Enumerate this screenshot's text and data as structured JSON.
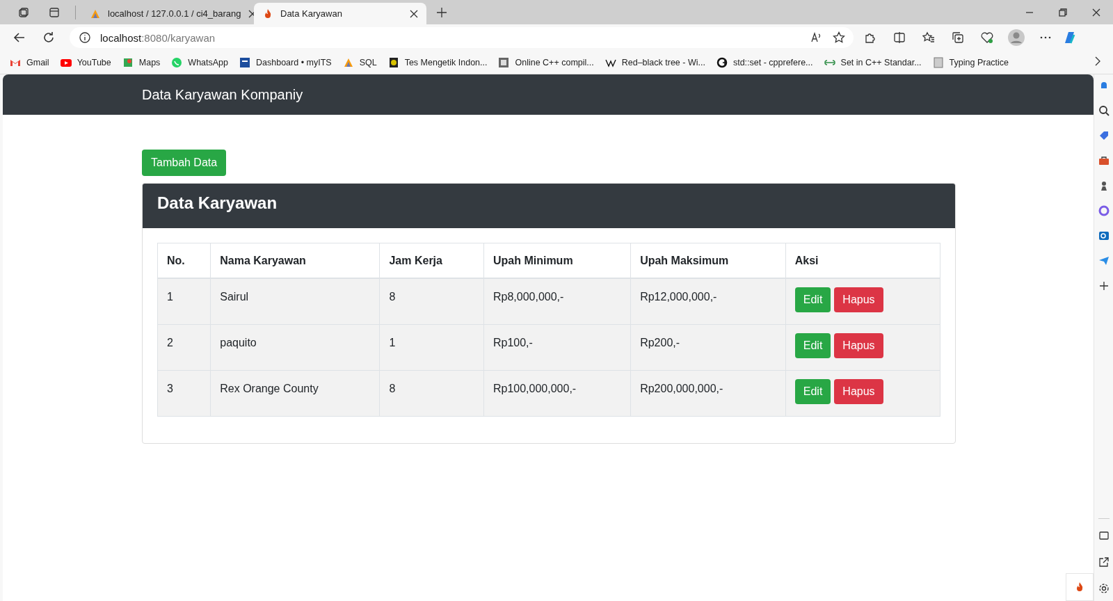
{
  "browser": {
    "tabs": [
      {
        "title": "localhost / 127.0.0.1 / ci4_barang",
        "kind": "pma",
        "selected": false
      },
      {
        "title": "Data Karyawan",
        "kind": "flame",
        "selected": true
      }
    ],
    "address": {
      "host": "localhost",
      "path": ":8080/karyawan"
    },
    "bookmarks": [
      {
        "label": "Gmail",
        "kind": "gmail"
      },
      {
        "label": "YouTube",
        "kind": "youtube"
      },
      {
        "label": "Maps",
        "kind": "maps"
      },
      {
        "label": "WhatsApp",
        "kind": "whatsapp"
      },
      {
        "label": "Dashboard • myITS",
        "kind": "its"
      },
      {
        "label": "SQL",
        "kind": "pma"
      },
      {
        "label": "Tes Mengetik Indon...",
        "kind": "badge"
      },
      {
        "label": "Online C++ compil...",
        "kind": "ide"
      },
      {
        "label": "Red–black tree - Wi...",
        "kind": "wiki"
      },
      {
        "label": "std::set - cpprefere...",
        "kind": "cpp"
      },
      {
        "label": "Set in C++ Standar...",
        "kind": "gfg"
      },
      {
        "label": "Typing Practice",
        "kind": "doc"
      }
    ]
  },
  "navbar": {
    "brand": "Data Karyawan Kompaniy"
  },
  "add_button": "Tambah Data",
  "card": {
    "title": "Data Karyawan",
    "table": {
      "columns": [
        "No.",
        "Nama Karyawan",
        "Jam Kerja",
        "Upah Minimum",
        "Upah Maksimum",
        "Aksi"
      ],
      "rows": [
        {
          "cells": [
            "1",
            "Sairul",
            "8",
            "Rp8,000,000,-",
            "Rp12,000,000,-"
          ],
          "actions": [
            {
              "label": "Edit",
              "kind": "edit"
            },
            {
              "label": "Hapus",
              "kind": "delete"
            }
          ]
        },
        {
          "cells": [
            "2",
            "paquito",
            "1",
            "Rp100,-",
            "Rp200,-"
          ],
          "actions": [
            {
              "label": "Edit",
              "kind": "edit"
            },
            {
              "label": "Hapus",
              "kind": "delete"
            }
          ]
        },
        {
          "cells": [
            "3",
            "Rex Orange County",
            "8",
            "Rp100,000,000,-",
            "Rp200,000,000,-"
          ],
          "actions": [
            {
              "label": "Edit",
              "kind": "edit"
            },
            {
              "label": "Hapus",
              "kind": "delete"
            }
          ]
        }
      ]
    }
  }
}
